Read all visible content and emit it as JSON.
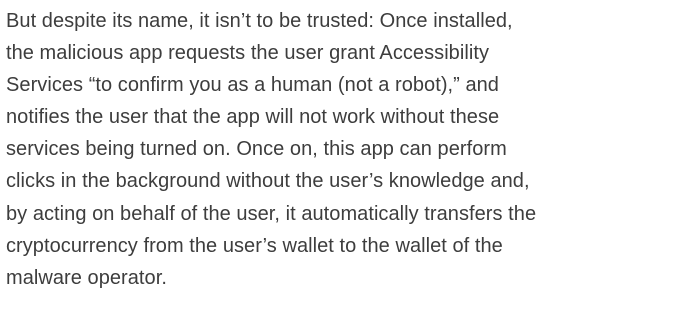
{
  "article": {
    "paragraph_lines": [
      "But despite its name, it isn’t to be trusted: Once installed,",
      "the malicious app requests the user grant Accessibility",
      "Services “to confirm you as a human (not a robot),” and",
      "notifies the user that the app will not work without these",
      "services being turned on. Once on, this app can perform",
      "clicks in the background without the user’s knowledge and,",
      "by acting on behalf of the user, it automatically transfers the",
      "cryptocurrency from the user’s wallet to the wallet of the",
      "malware operator."
    ]
  }
}
